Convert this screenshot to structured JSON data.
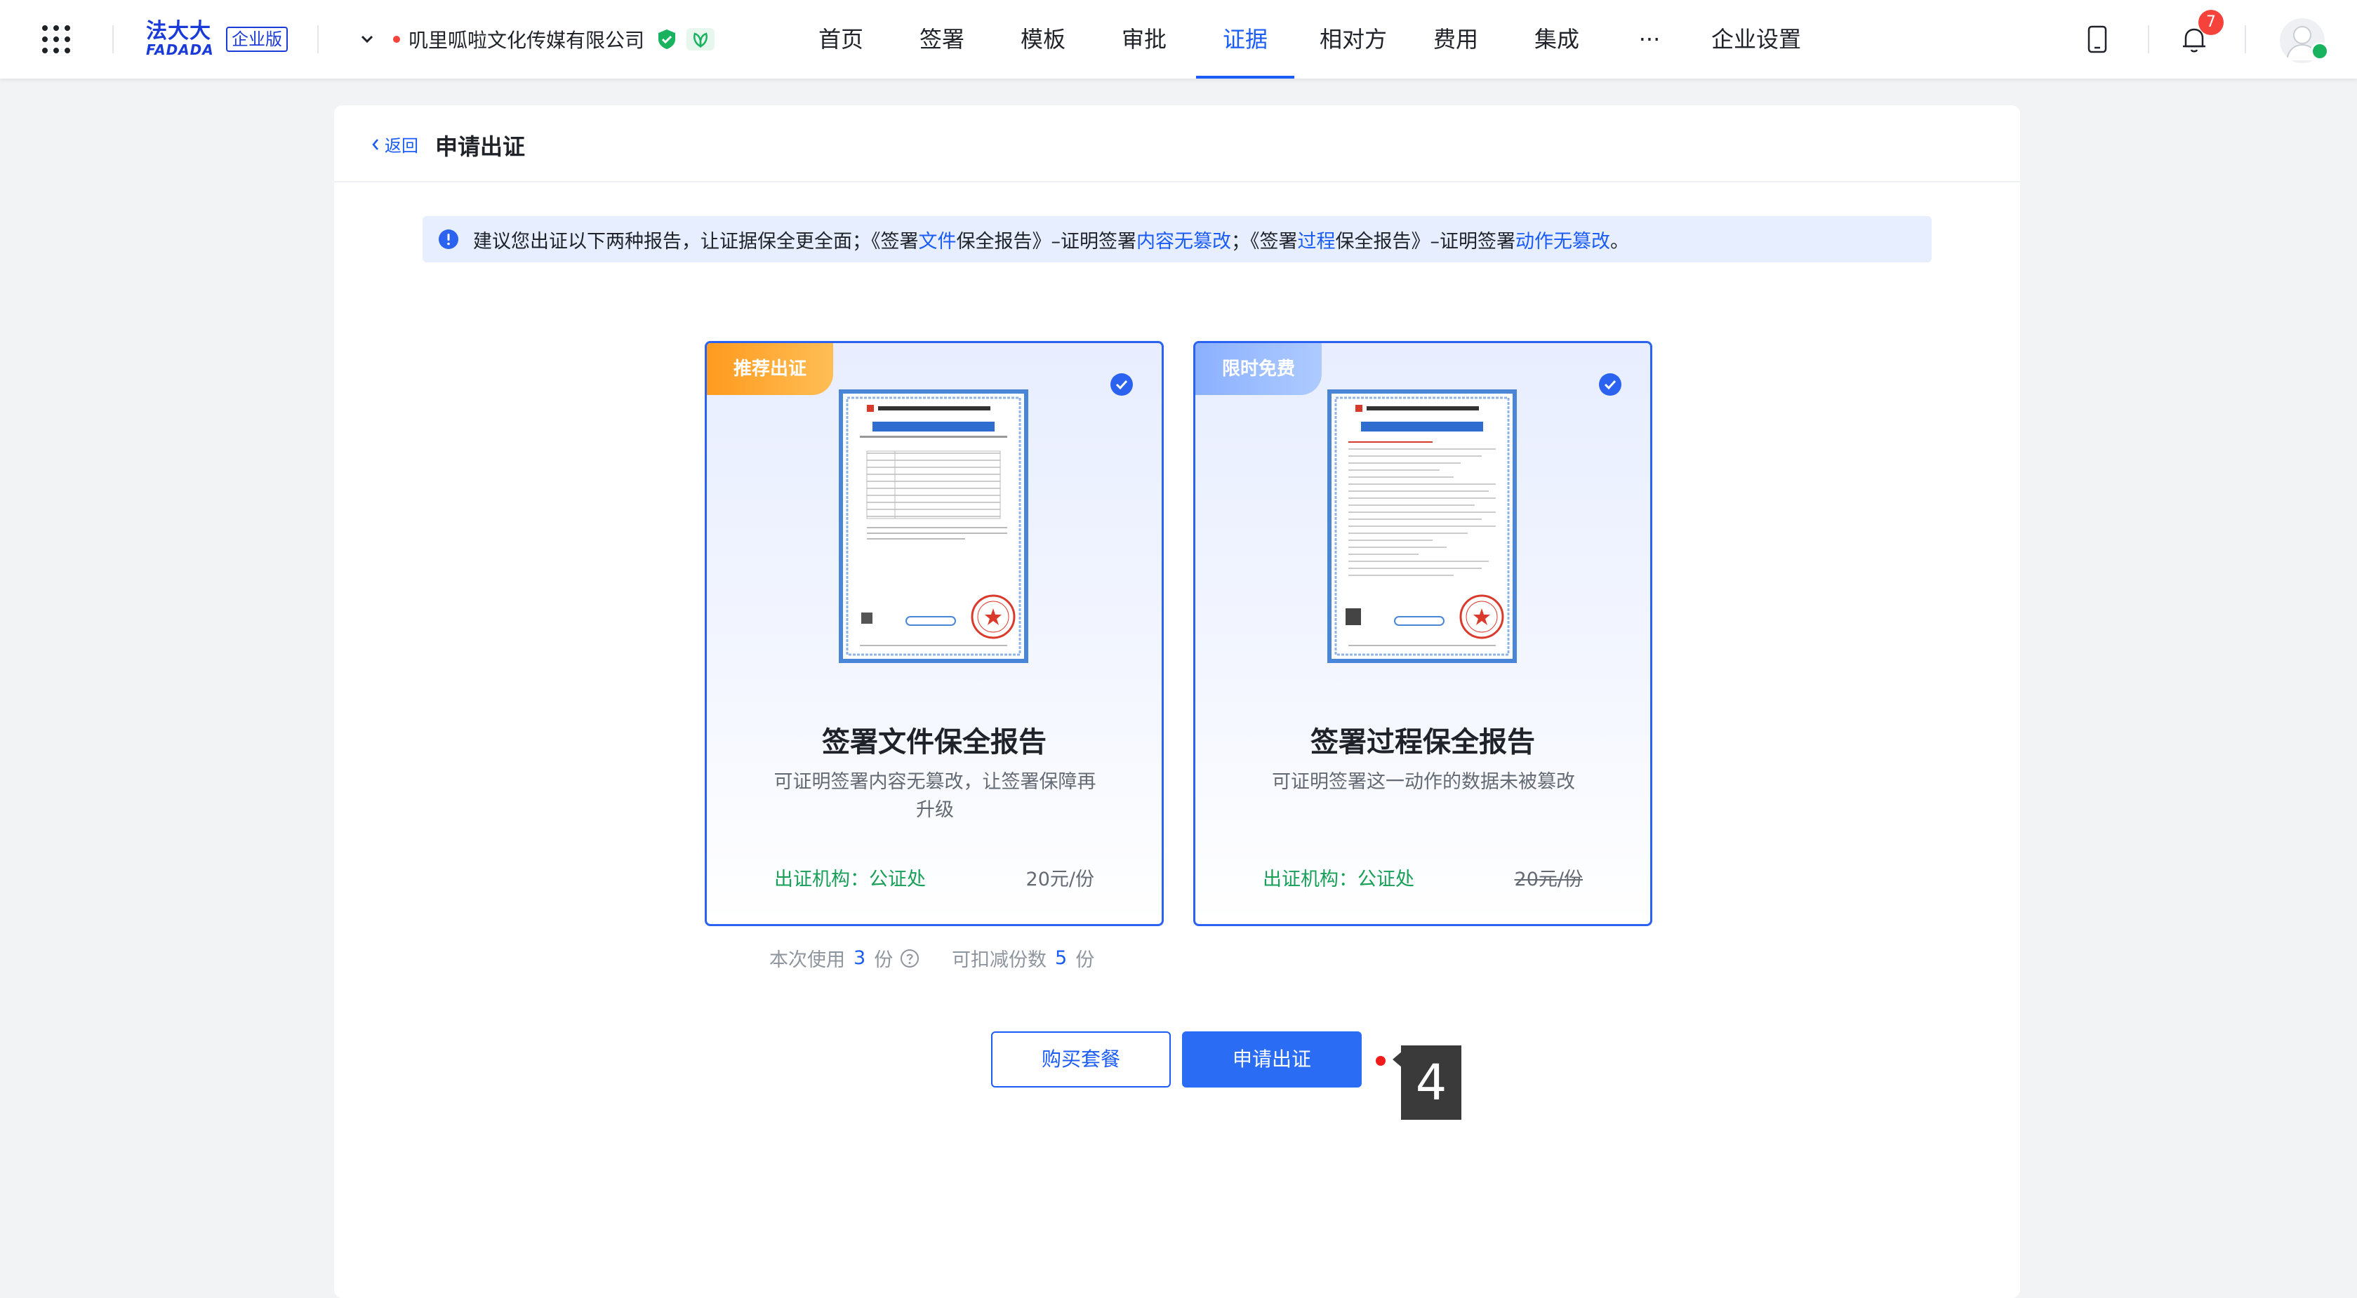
{
  "header": {
    "brand_top": "法大大",
    "brand_bottom": "FADADA",
    "edition": "企业版",
    "company_name": "叽里呱啦文化传媒有限公司",
    "nav": [
      "首页",
      "签署",
      "模板",
      "审批",
      "证据",
      "相对方",
      "费用",
      "集成",
      "···",
      "企业设置"
    ],
    "active_nav": "证据",
    "notification_count": "7"
  },
  "page": {
    "back_label": "返回",
    "title": "申请出证",
    "tip": {
      "p1": "建议您出证以下两种报告，让证据保全更全面；《签署",
      "h1": "文件",
      "p2": "保全报告》–证明签署",
      "h2": "内容无篡改",
      "p3": "；《签署",
      "h3": "过程",
      "p4": "保全报告》–证明签署",
      "h4": "动作无篡改",
      "p5": "。"
    },
    "cards": [
      {
        "tag": "推荐出证",
        "title": "签署文件保全报告",
        "desc": "可证明签署内容无篡改，让签署保障再升级",
        "org": "出证机构：公证处",
        "price": "20元/份",
        "price_struck": false,
        "selected": true
      },
      {
        "tag": "限时免费",
        "title": "签署过程保全报告",
        "desc": "可证明签署这一动作的数据未被篡改",
        "org": "出证机构：公证处",
        "price": "20元/份",
        "price_struck": true,
        "selected": true
      }
    ],
    "usage": {
      "this_time_label": "本次使用",
      "this_time_value": "3",
      "unit": "份",
      "deductible_label": "可扣减份数",
      "deductible_value": "5"
    },
    "buttons": {
      "buy": "购买套餐",
      "apply": "申请出证"
    },
    "step_marker": "4"
  }
}
